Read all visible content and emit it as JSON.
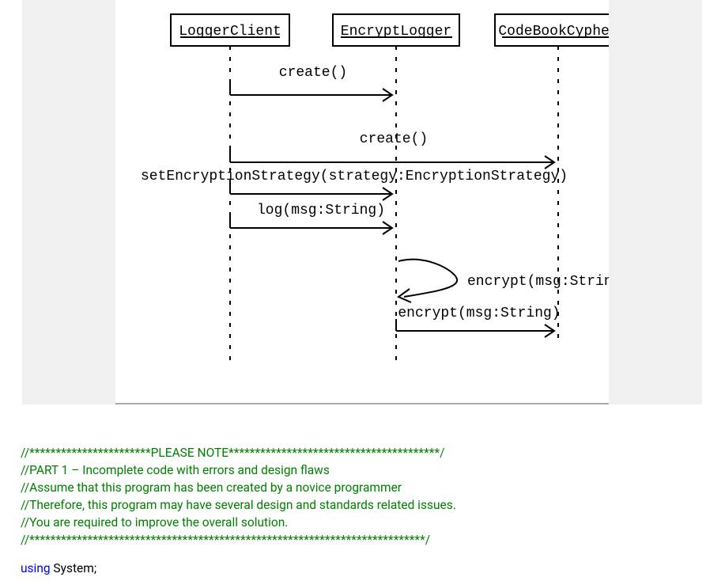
{
  "diagram": {
    "lifelines": [
      {
        "name": "LoggerClient"
      },
      {
        "name": "EncryptLogger"
      },
      {
        "name": "CodeBookCypher"
      }
    ],
    "messages": {
      "create1": "create()",
      "create2": "create()",
      "setStrategy": "setEncryptionStrategy(strategy:EncryptionStrategy)",
      "log": "log(msg:String)",
      "selfEncrypt": "encrypt(msg:String)",
      "encrypt": "encrypt(msg:String)"
    }
  },
  "ellipsis": "...",
  "code": {
    "c1": "//***********************PLEASE NOTE****************************************/",
    "c2": "//PART 1 – Incomplete code with errors and design flaws",
    "c3": "//Assume that this program has been created by a novice programmer",
    "c4": "//Therefore, this program may have several design and standards related issues.",
    "c5": "//You are required to improve the overall solution.",
    "c6": "//***************************************************************************/",
    "using_kw": "using",
    "using_ns": " System;"
  }
}
